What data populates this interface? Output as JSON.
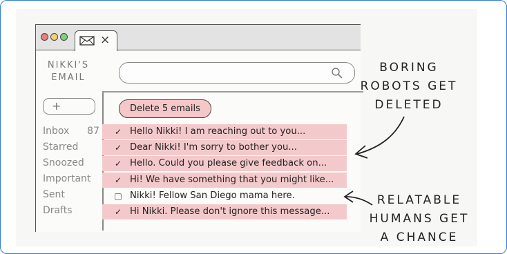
{
  "window": {
    "tab_icon": "envelope-icon",
    "close_label": "×"
  },
  "brand": {
    "line1": "NIKKI'S",
    "line2": "EMAIL"
  },
  "search": {
    "placeholder": "",
    "icon": "search-icon"
  },
  "compose": {
    "label": "+"
  },
  "nav": {
    "items": [
      {
        "label": "Inbox",
        "count": "87"
      },
      {
        "label": "Starred"
      },
      {
        "label": "Snoozed"
      },
      {
        "label": "Important"
      },
      {
        "label": "Sent"
      },
      {
        "label": "Drafts"
      }
    ]
  },
  "toolbar": {
    "delete_label": "Delete 5 emails"
  },
  "emails": [
    {
      "subject": "Hello Nikki! I am reaching out to you...",
      "checked": true,
      "check": "✓"
    },
    {
      "subject": "Dear Nikki! I'm sorry to bother you...",
      "checked": true,
      "check": "✓"
    },
    {
      "subject": "Hello. Could you please give feedback on...",
      "checked": true,
      "check": "✓"
    },
    {
      "subject": "Hi! We have something that you might like...",
      "checked": true,
      "check": "✓"
    },
    {
      "subject": "Nikki! Fellow San Diego mama here.",
      "checked": false,
      "check": ""
    },
    {
      "subject": "Hi Nikki. Please don't ignore this message...",
      "checked": true,
      "check": "✓"
    }
  ],
  "annotations": {
    "top": [
      "BORING",
      "ROBOTS GET",
      "DELETED"
    ],
    "bottom": [
      "RELATABLE",
      "HUMANS GET",
      "A CHANCE"
    ]
  },
  "colors": {
    "selected_row": "#f4c9cb",
    "delete_button": "#f6c7c9",
    "frame_border": "#2f7fd4"
  }
}
